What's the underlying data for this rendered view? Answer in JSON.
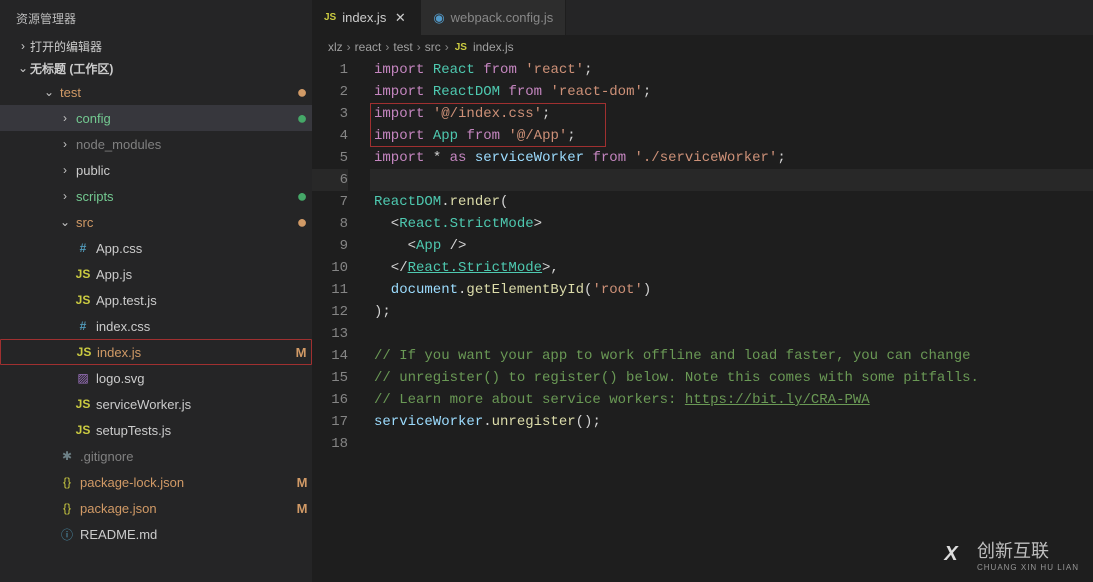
{
  "explorer": {
    "title": "资源管理器",
    "sections": {
      "open_editors": "打开的编辑器",
      "workspace": "无标题 (工作区)"
    }
  },
  "tree": {
    "test": "test",
    "config": "config",
    "node_modules": "node_modules",
    "public": "public",
    "scripts": "scripts",
    "src": "src",
    "files": {
      "app_css": "App.css",
      "app_js": "App.js",
      "app_test_js": "App.test.js",
      "index_css": "index.css",
      "index_js": "index.js",
      "logo_svg": "logo.svg",
      "service_worker": "serviceWorker.js",
      "setup_tests": "setupTests.js",
      "gitignore": ".gitignore",
      "pkg_lock": "package-lock.json",
      "pkg_json": "package.json",
      "readme": "README.md"
    },
    "status": {
      "m": "M"
    }
  },
  "tabs": {
    "index_js": "index.js",
    "webpack": "webpack.config.js"
  },
  "breadcrumb": [
    "xlz",
    "react",
    "test",
    "src",
    "index.js"
  ],
  "icon_label_js": "JS",
  "code": {
    "l1": {
      "import": "import",
      "react": "React",
      "from": "from",
      "str": "'react'",
      "semi": ";"
    },
    "l2": {
      "import": "import",
      "reactdom": "ReactDOM",
      "from": "from",
      "str": "'react-dom'",
      "semi": ";"
    },
    "l3": {
      "import": "import",
      "str": "'@/index.css'",
      "semi": ";"
    },
    "l4": {
      "import": "import",
      "app": "App",
      "from": "from",
      "str": "'@/App'",
      "semi": ";"
    },
    "l5": {
      "import": "import",
      "star": "*",
      "as": "as",
      "sw": "serviceWorker",
      "from": "from",
      "str": "'./serviceWorker'",
      "semi": ";"
    },
    "l7": {
      "reactdom": "ReactDOM",
      "dot": ".",
      "render": "render",
      "paren": "("
    },
    "l8": {
      "open": "  <",
      "tag": "React.StrictMode",
      "close": ">"
    },
    "l9": {
      "open": "    <",
      "tag": "App",
      "close": " />"
    },
    "l10": {
      "open": "  </",
      "tag": "React.StrictMode",
      "close": ">,"
    },
    "l11": {
      "doc": "  document",
      "dot": ".",
      "get": "getElementById",
      "p1": "(",
      "str": "'root'",
      "p2": ")"
    },
    "l12": ");",
    "l14": "// If you want your app to work offline and load faster, you can change",
    "l15": "// unregister() to register() below. Note this comes with some pitfalls.",
    "l16a": "// Learn more about service workers: ",
    "l16b": "https://bit.ly/CRA-PWA",
    "l17": {
      "sw": "serviceWorker",
      "dot": ".",
      "un": "unregister",
      "call": "();"
    }
  },
  "watermark": {
    "logo": "X",
    "cn": "创新互联",
    "en": "CHUANG XIN HU LIAN"
  }
}
